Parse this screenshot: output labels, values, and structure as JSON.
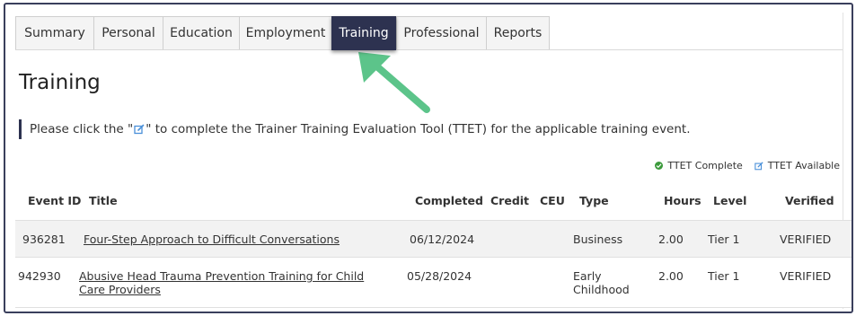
{
  "tabs": [
    {
      "label": "Summary",
      "active": false
    },
    {
      "label": "Personal",
      "active": false
    },
    {
      "label": "Education",
      "active": false
    },
    {
      "label": "Employment",
      "active": false
    },
    {
      "label": "Training",
      "active": true
    },
    {
      "label": "Professional",
      "active": false
    },
    {
      "label": "Reports",
      "active": false
    }
  ],
  "page_title": "Training",
  "notice": {
    "before": "Please click the \"",
    "after": " \" to complete the Trainer Training Evaluation Tool (TTET) for the applicable training event."
  },
  "legend": {
    "complete": "TTET Complete",
    "available": "TTET Available"
  },
  "table": {
    "headers": [
      "Event ID",
      "Title",
      "Completed",
      "Credit",
      "CEU",
      "Type",
      "Hours",
      "Level",
      "Verified"
    ],
    "rows": [
      {
        "event_id": "936281",
        "title": "Four-Step Approach to Difficult Conversations",
        "completed": "06/12/2024",
        "credit": "",
        "ceu": "",
        "type": "Business",
        "hours": "2.00",
        "level": "Tier 1",
        "verified": "VERIFIED"
      },
      {
        "event_id": "942930",
        "title": "Abusive Head Trauma Prevention Training for Child Care Providers",
        "completed": "05/28/2024",
        "credit": "",
        "ceu": "",
        "type": "Early Childhood",
        "hours": "2.00",
        "level": "Tier 1",
        "verified": "VERIFIED"
      }
    ]
  },
  "colors": {
    "active_tab": "#2d3250",
    "arrow": "#5cc48a",
    "complete_dot": "#3c9a3c",
    "edit_icon": "#4a90d9"
  },
  "icons": {
    "edit": "edit-icon",
    "complete": "check-circle-icon",
    "arrow": "arrow-pointer-icon"
  }
}
